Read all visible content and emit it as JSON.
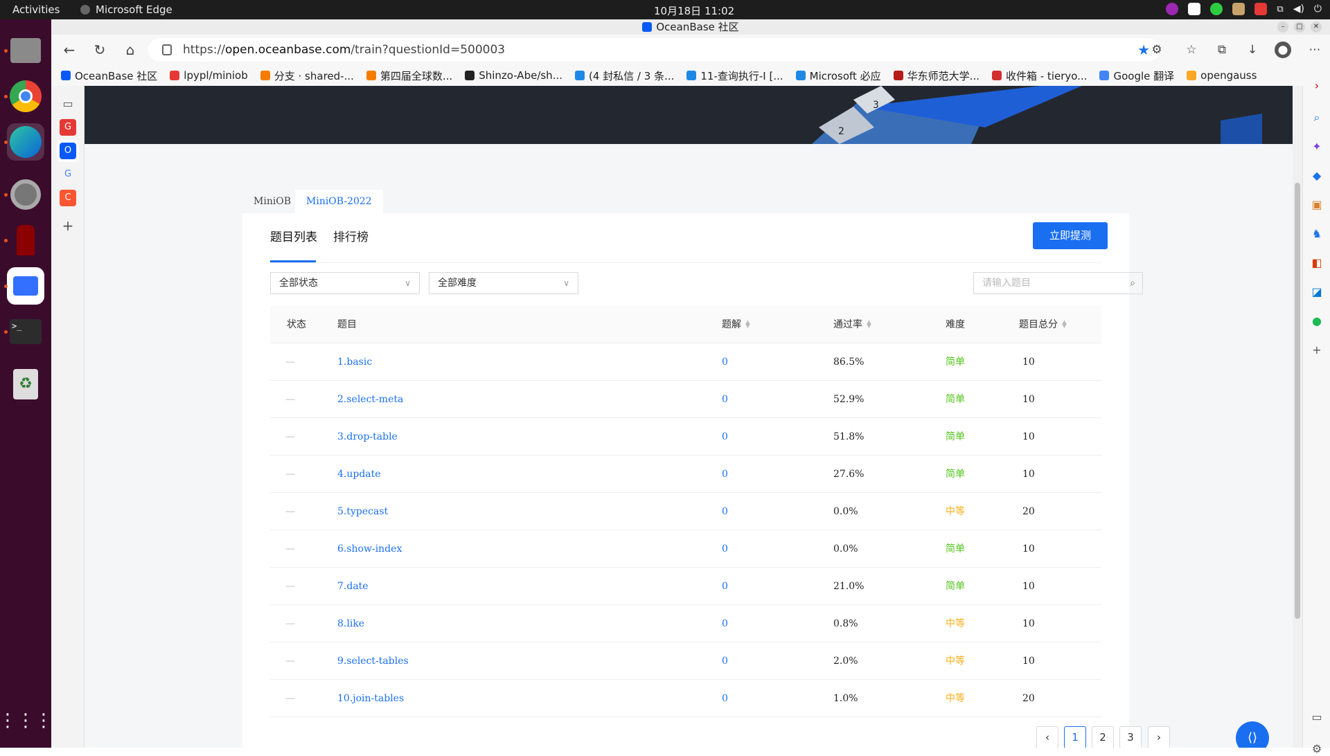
{
  "topbar": {
    "activities": "Activities",
    "app": "Microsoft Edge",
    "clock": "10月18日  11:02"
  },
  "window": {
    "title": "OceanBase 社区"
  },
  "address": {
    "url_prefix": "https://",
    "url_host": "open.oceanbase.com",
    "url_path": "/train?questionId=500003"
  },
  "bookmarks": [
    {
      "label": "OceanBase 社区",
      "color": "#0a59f7"
    },
    {
      "label": "lpypl/miniob",
      "color": "#e53935"
    },
    {
      "label": "分支 · shared-...",
      "color": "#f57c00"
    },
    {
      "label": "第四届全球数...",
      "color": "#f57c00"
    },
    {
      "label": "Shinzo-Abe/sh...",
      "color": "#222222"
    },
    {
      "label": "(4 封私信 / 3 条...",
      "color": "#1e88e5"
    },
    {
      "label": "11-查询执行-I [...",
      "color": "#1e88e5"
    },
    {
      "label": "Microsoft 必应",
      "color": "#1e88e5"
    },
    {
      "label": "华东师范大学...",
      "color": "#b71c1c"
    },
    {
      "label": "收件箱 - tieryo...",
      "color": "#d32f2f"
    },
    {
      "label": "Google 翻译",
      "color": "#4285f4"
    },
    {
      "label": "opengauss",
      "color": "#f9a825"
    }
  ],
  "page": {
    "top_tabs": [
      "MiniOB",
      "MiniOB-2022"
    ],
    "sub_tabs": [
      "题目列表",
      "排行榜"
    ],
    "submit_label": "立即提测",
    "filter_status": "全部状态",
    "filter_difficulty": "全部难度",
    "search_placeholder": "请输入题目",
    "columns": {
      "status": "状态",
      "title": "题目",
      "solutions": "题解",
      "pass_rate": "通过率",
      "difficulty": "难度",
      "score": "题目总分"
    },
    "rows": [
      {
        "status": "—",
        "title": "1.basic",
        "solutions": "0",
        "pass_rate": "86.5%",
        "difficulty": "简单",
        "score": "10"
      },
      {
        "status": "—",
        "title": "2.select-meta",
        "solutions": "0",
        "pass_rate": "52.9%",
        "difficulty": "简单",
        "score": "10"
      },
      {
        "status": "—",
        "title": "3.drop-table",
        "solutions": "0",
        "pass_rate": "51.8%",
        "difficulty": "简单",
        "score": "10"
      },
      {
        "status": "—",
        "title": "4.update",
        "solutions": "0",
        "pass_rate": "27.6%",
        "difficulty": "简单",
        "score": "10"
      },
      {
        "status": "—",
        "title": "5.typecast",
        "solutions": "0",
        "pass_rate": "0.0%",
        "difficulty": "中等",
        "score": "20"
      },
      {
        "status": "—",
        "title": "6.show-index",
        "solutions": "0",
        "pass_rate": "0.0%",
        "difficulty": "简单",
        "score": "10"
      },
      {
        "status": "—",
        "title": "7.date",
        "solutions": "0",
        "pass_rate": "21.0%",
        "difficulty": "简单",
        "score": "10"
      },
      {
        "status": "—",
        "title": "8.like",
        "solutions": "0",
        "pass_rate": "0.8%",
        "difficulty": "中等",
        "score": "10"
      },
      {
        "status": "—",
        "title": "9.select-tables",
        "solutions": "0",
        "pass_rate": "2.0%",
        "difficulty": "中等",
        "score": "10"
      },
      {
        "status": "—",
        "title": "10.join-tables",
        "solutions": "0",
        "pass_rate": "1.0%",
        "difficulty": "中等",
        "score": "20"
      }
    ],
    "pagination": {
      "prev": "‹",
      "pages": [
        "1",
        "2",
        "3"
      ],
      "next": "›",
      "current": "1"
    }
  },
  "colors": {
    "accent": "#1a6ff0",
    "easy": "#52c41a",
    "medium": "#faad14"
  }
}
